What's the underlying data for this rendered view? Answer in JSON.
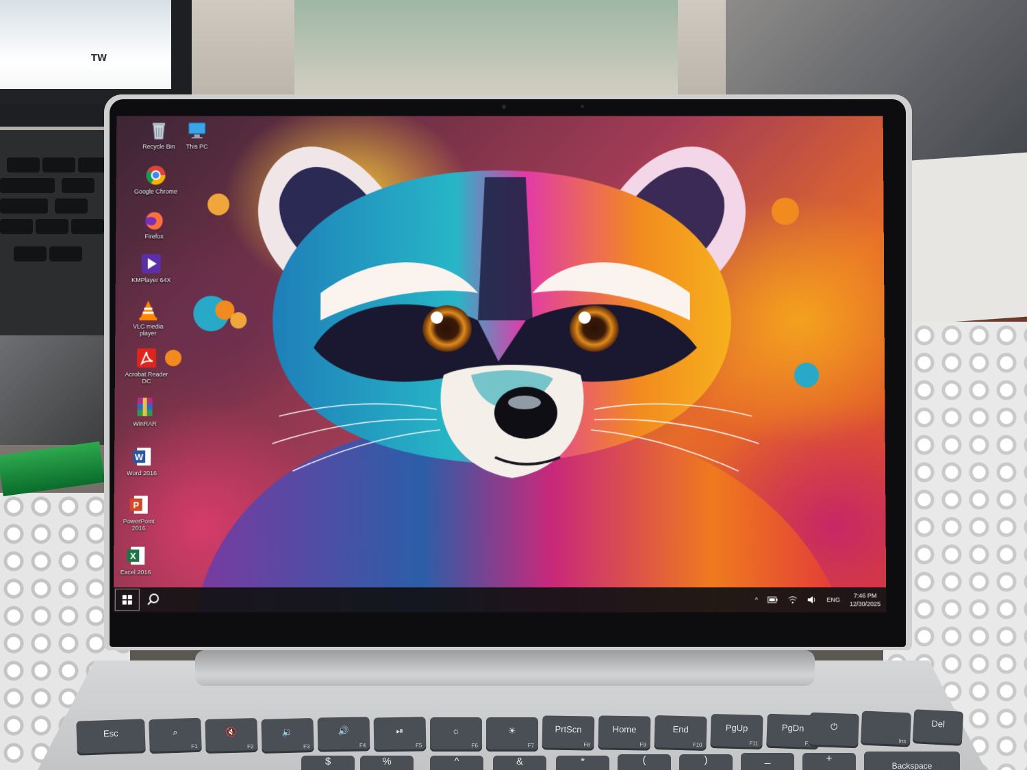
{
  "background_laptop": {
    "screen_text": "TW"
  },
  "desktop": {
    "icons": [
      {
        "label": "Recycle Bin",
        "icon": "recycle-bin-icon"
      },
      {
        "label": "This PC",
        "icon": "this-pc-icon"
      },
      {
        "label": "Google Chrome",
        "icon": "chrome-icon"
      },
      {
        "label": "Firefox",
        "icon": "firefox-icon"
      },
      {
        "label": "KMPlayer 64X",
        "icon": "kmplayer-icon"
      },
      {
        "label": "VLC media player",
        "icon": "vlc-icon"
      },
      {
        "label": "Acrobat Reader DC",
        "icon": "acrobat-icon"
      },
      {
        "label": "WinRAR",
        "icon": "winrar-icon"
      },
      {
        "label": "Word 2016",
        "icon": "word-icon"
      },
      {
        "label": "PowerPoint 2016",
        "icon": "powerpoint-icon"
      },
      {
        "label": "Excel 2016",
        "icon": "excel-icon"
      }
    ],
    "wallpaper": "colorful-raccoon-painting"
  },
  "taskbar": {
    "start_icon": "windows-logo-icon",
    "search_icon": "search-icon",
    "tray": {
      "chevron": "^",
      "language": "ENG",
      "time": "7:46 PM",
      "date": "12/30/2025"
    }
  },
  "keyboard": {
    "function_row": [
      {
        "label": "Esc",
        "fn": ""
      },
      {
        "label": "⌕",
        "fn": "F1"
      },
      {
        "label": "🔇",
        "fn": "F2"
      },
      {
        "label": "🔉",
        "fn": "F3"
      },
      {
        "label": "🔊",
        "fn": "F4"
      },
      {
        "label": "⏯",
        "fn": "F5"
      },
      {
        "label": "☼",
        "fn": "F6"
      },
      {
        "label": "☀",
        "fn": "F7"
      },
      {
        "label": "PrtScn",
        "fn": "F8"
      },
      {
        "label": "Home",
        "fn": "F9"
      },
      {
        "label": "End",
        "fn": "F10"
      },
      {
        "label": "PgUp",
        "fn": "F11"
      },
      {
        "label": "PgDn",
        "fn": "F12"
      },
      {
        "label": "⏻",
        "fn": ""
      },
      {
        "label": "",
        "fn": "Ins"
      },
      {
        "label": "Del",
        "fn": ""
      }
    ],
    "number_row": [
      "$",
      "%",
      "^",
      "&",
      "*",
      "(",
      ")",
      "_",
      "+",
      "Backspace"
    ]
  },
  "colors": {
    "taskbar": "#121214",
    "key": "#4a4f55",
    "chassis": "#cfcfd0"
  }
}
